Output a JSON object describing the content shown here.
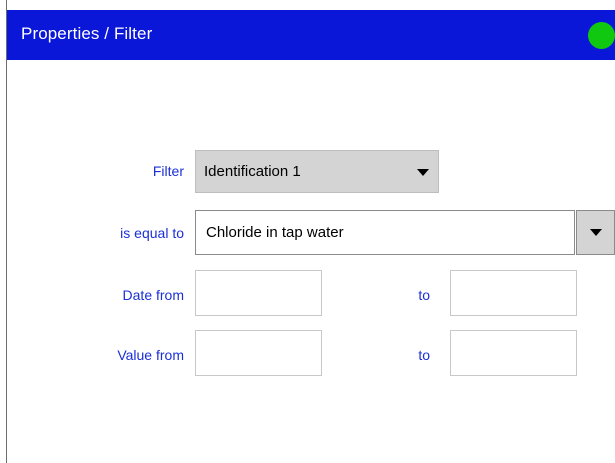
{
  "window": {
    "title": "Properties / Filter",
    "status_color": "#10c810"
  },
  "form": {
    "filter_label": "Filter",
    "filter_value": "Identification 1",
    "equal_label": "is equal to",
    "equal_value": "Chloride in tap water",
    "date_from_label": "Date from",
    "date_to_label": "to",
    "date_from_value": "",
    "date_to_value": "",
    "value_from_label": "Value from",
    "value_to_label": "to",
    "value_from_value": "",
    "value_to_value": ""
  },
  "icons": {
    "dropdown": "chevron-down-icon",
    "status": "status-indicator-icon"
  }
}
